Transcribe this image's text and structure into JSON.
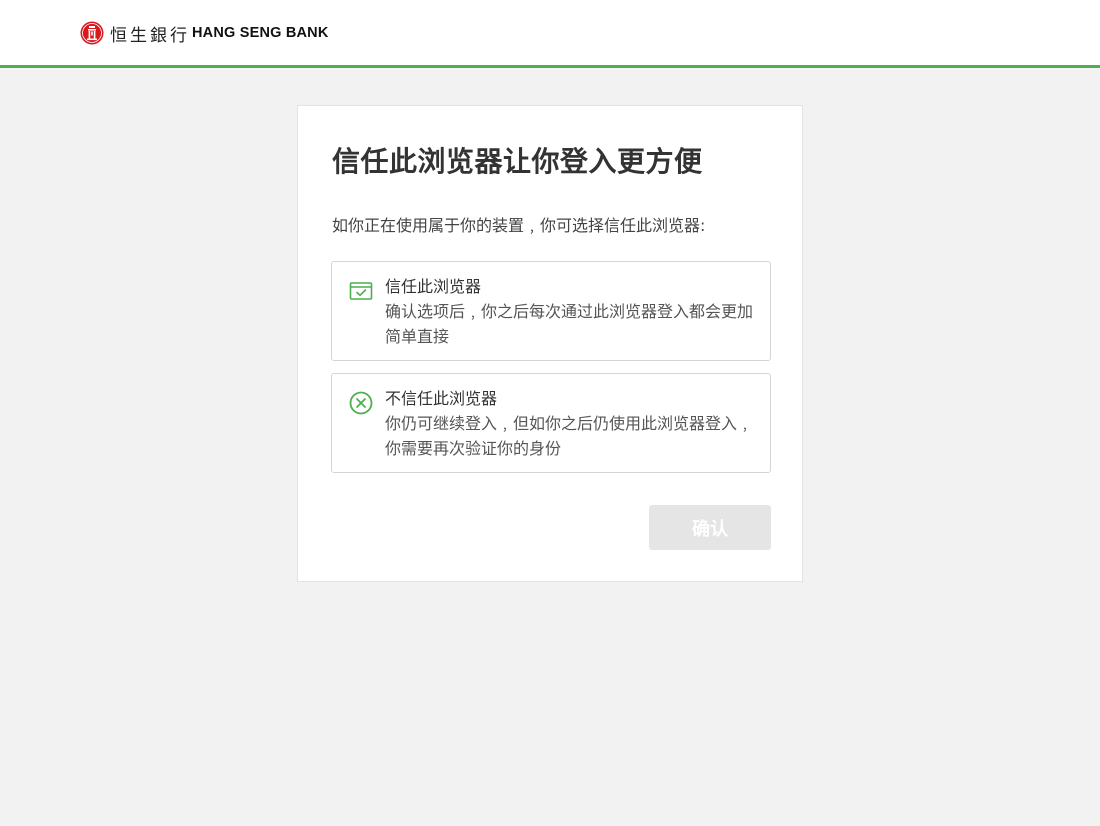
{
  "header": {
    "logo_chinese": "恒生銀行",
    "logo_english": "HANG SENG BANK",
    "accent_color": "#4caf50",
    "brand_color": "#d71920"
  },
  "dialog": {
    "title": "信任此浏览器让你登入更方便",
    "subtitle": "如你正在使用属于你的装置﹐你可选择信任此浏览器:",
    "options": [
      {
        "icon": "browser-check-icon",
        "title": "信任此浏览器",
        "description": "确认选项后﹐你之后每次通过此浏览器登入都会更加简单直接"
      },
      {
        "icon": "circle-x-icon",
        "title": "不信任此浏览器",
        "description": "你仍可继续登入﹐但如你之后仍使用此浏览器登入﹐你需要再次验证你的身份"
      }
    ],
    "confirm_label": "确认",
    "confirm_state": "disabled"
  }
}
